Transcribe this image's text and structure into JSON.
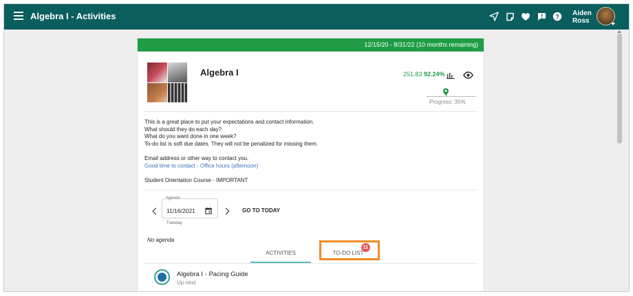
{
  "app": {
    "title": "Algebra I - Activities",
    "user_first": "Aiden",
    "user_last": "Ross",
    "accent_color": "#0b5e5e"
  },
  "topbar_icons": [
    "send-icon",
    "note-icon",
    "heart-icon",
    "feedback-icon",
    "help-icon"
  ],
  "course": {
    "date_range": "12/15/20 - 8/31/22 (10 months remaining)",
    "title": "Algebra I",
    "points": "251.83",
    "percent": "92.24%",
    "progress_text": "Progress: 35%",
    "progress_fraction": 0.35
  },
  "description": {
    "line1": "This is a great place to put your expectations and contact information.",
    "line2": "What should they do each day?",
    "line3": "What do you want done in one week?",
    "line4": "To-do list is soft due dates. They will not be penalized for missing them.",
    "line5": "Email address or other way to contact you.",
    "line6": "Good time to contact - Office hours (afternoon)",
    "line7": "Student Orientation Course - IMPORTANT"
  },
  "agenda": {
    "label": "Agenda",
    "date": "11/16/2021",
    "weekday": "Tuesday",
    "goto_today": "GO TO TODAY",
    "empty": "No agenda"
  },
  "tabs": {
    "activities": "ACTIVITIES",
    "todo": "TO-DO LIST",
    "todo_badge": "11"
  },
  "list": [
    {
      "title": "Algebra I - Pacing Guide",
      "subtitle": "Up next"
    }
  ]
}
